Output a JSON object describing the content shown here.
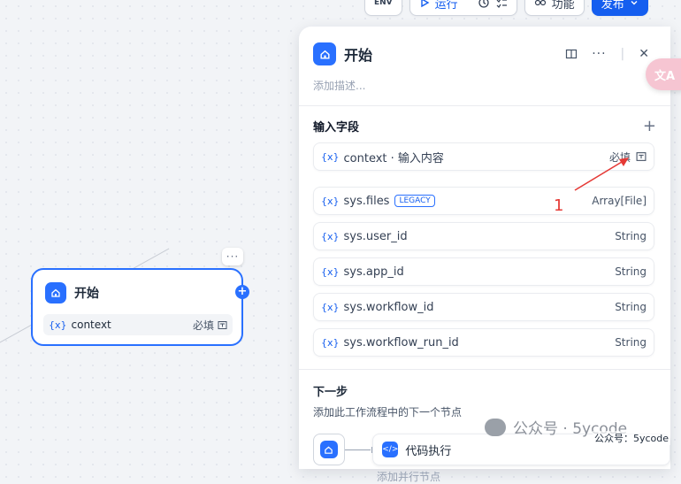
{
  "toolbar": {
    "env_label": "ENV",
    "run_label": "运行",
    "features_label": "功能",
    "publish_label": "发布"
  },
  "canvas_node": {
    "title": "开始",
    "var_symbol": "{x}",
    "var_name": "context",
    "required": "必填"
  },
  "panel": {
    "title": "开始",
    "description_placeholder": "添加描述...",
    "input_section_title": "输入字段",
    "user_fields": [
      {
        "symbol": "{x}",
        "name": "context · 输入内容",
        "required": "必填"
      }
    ],
    "system_fields": [
      {
        "symbol": "{x}",
        "name": "sys.files",
        "badge": "LEGACY",
        "type": "Array[File]"
      },
      {
        "symbol": "{x}",
        "name": "sys.user_id",
        "type": "String"
      },
      {
        "symbol": "{x}",
        "name": "sys.app_id",
        "type": "String"
      },
      {
        "symbol": "{x}",
        "name": "sys.workflow_id",
        "type": "String"
      },
      {
        "symbol": "{x}",
        "name": "sys.workflow_run_id",
        "type": "String"
      }
    ],
    "next_step_title": "下一步",
    "next_step_desc": "添加此工作流程中的下一个节点",
    "next_node_label": "代码执行",
    "parallel_label": "添加并行节点"
  },
  "annotation": {
    "label": "1",
    "color": "#e53935"
  },
  "translate_fab": "文A",
  "watermark": {
    "text": "公众号 · 5ycode",
    "credit": "公众号：5ycode"
  },
  "colors": {
    "accent": "#2970ff"
  }
}
